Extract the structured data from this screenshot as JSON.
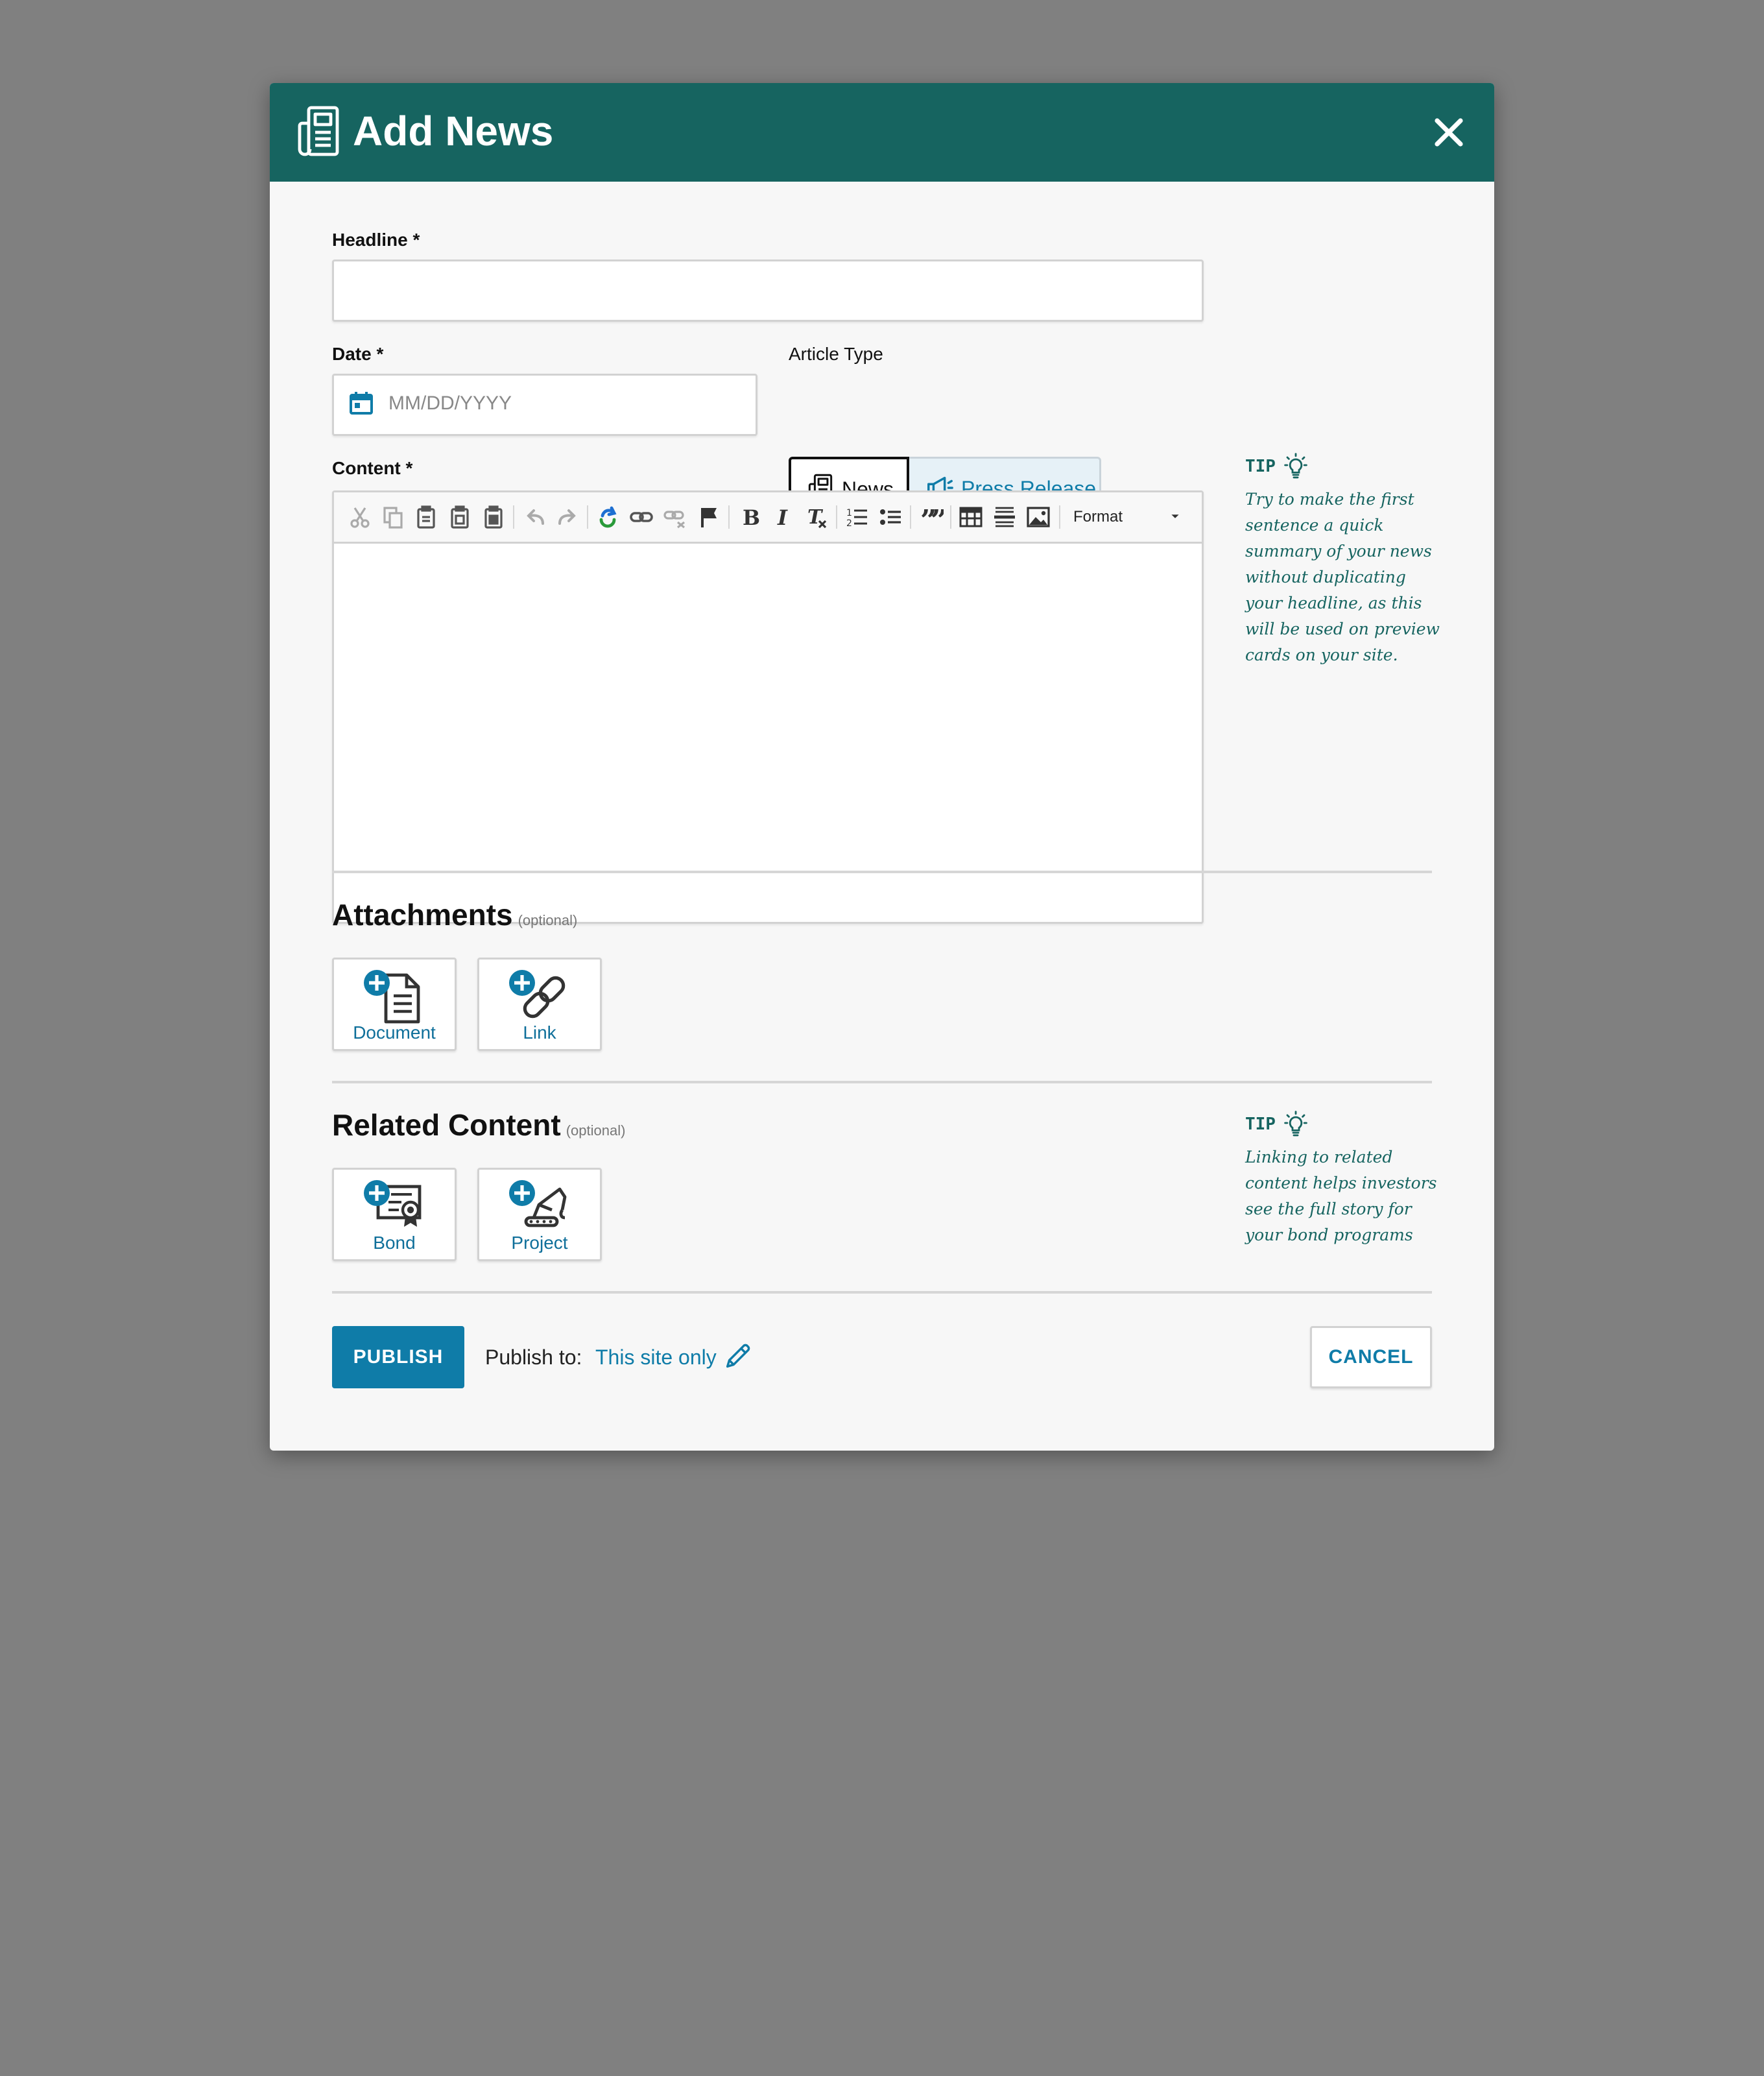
{
  "dialog": {
    "title": "Add News",
    "header_icon": "newspaper-icon",
    "close_icon": "close-icon",
    "accent_color": "#166460"
  },
  "form": {
    "headline": {
      "label": "Headline *",
      "value": ""
    },
    "date": {
      "label": "Date *",
      "placeholder": "MM/DD/YYYY",
      "icon": "calendar-icon"
    },
    "article_type": {
      "label": "Article Type",
      "options": [
        {
          "label": "News",
          "icon": "newspaper-icon",
          "selected": true
        },
        {
          "label": "Press Release",
          "icon": "megaphone-icon",
          "selected": false
        }
      ]
    },
    "content": {
      "label": "Content *",
      "toolbar": [
        "cut-icon",
        "copy-icon",
        "paste-icon",
        "paste-text-icon",
        "paste-word-icon",
        "undo-icon",
        "redo-icon",
        "link-color-icon",
        "link-icon",
        "unlink-icon",
        "anchor-flag-icon",
        "bold-icon",
        "italic-icon",
        "clear-format-icon",
        "numbered-list-icon",
        "bulleted-list-icon",
        "blockquote-icon",
        "table-icon",
        "horizontal-rule-icon",
        "image-icon"
      ],
      "format_label": "Format"
    }
  },
  "tips": {
    "content": {
      "heading": "TIP",
      "lines": [
        "Try to make the first",
        "sentence a quick",
        "summary of your news",
        "without duplicating",
        "your headline, as this",
        "will be used on preview",
        "cards on your site."
      ]
    },
    "related": {
      "heading": "TIP",
      "lines": [
        "Linking to related",
        "content helps investors",
        "see the full story for",
        "your bond programs"
      ]
    }
  },
  "attachments": {
    "title": "Attachments",
    "optional": "(optional)",
    "items": [
      {
        "label": "Document",
        "icon": "add-document-icon"
      },
      {
        "label": "Link",
        "icon": "add-link-icon"
      }
    ]
  },
  "related": {
    "title": "Related Content",
    "optional": "(optional)",
    "items": [
      {
        "label": "Bond",
        "icon": "add-bond-icon"
      },
      {
        "label": "Project",
        "icon": "add-project-icon"
      }
    ]
  },
  "footer": {
    "publish_label": "PUBLISH",
    "publish_to_label": "Publish to:",
    "publish_target": "This site only",
    "cancel_label": "CANCEL",
    "button_color": "#0f7ca8"
  }
}
